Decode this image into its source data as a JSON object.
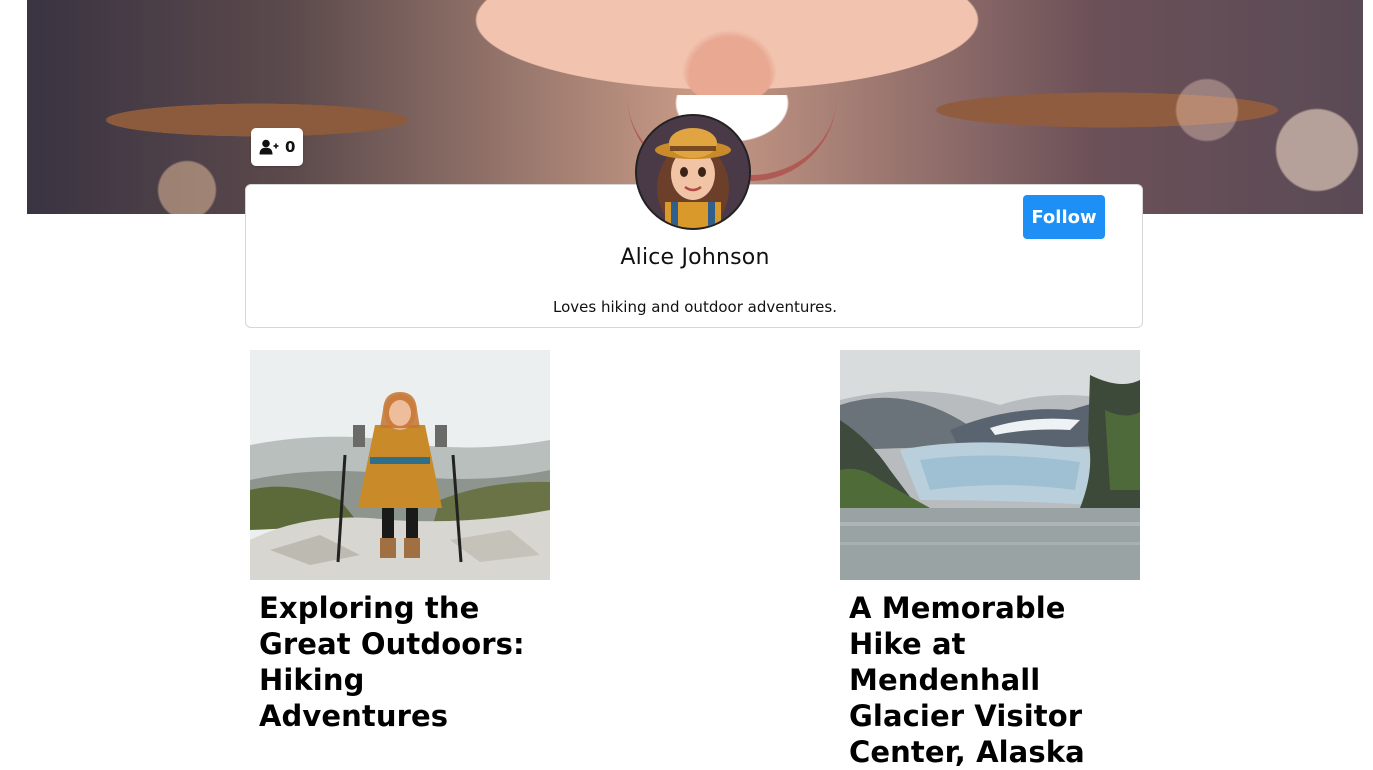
{
  "profile": {
    "name": "Alice Johnson",
    "bio": "Loves hiking and outdoor adventures.",
    "follow_label": "Follow",
    "followers_count": "0"
  },
  "icons": {
    "followers": "user-plus-icon"
  },
  "colors": {
    "follow_button": "#1e90f5"
  },
  "posts": [
    {
      "title": "Exploring the Great Outdoors: Hiking Adventures"
    },
    {
      "title": "A Memorable Hike at Mendenhall Glacier Visitor Center, Alaska"
    }
  ]
}
